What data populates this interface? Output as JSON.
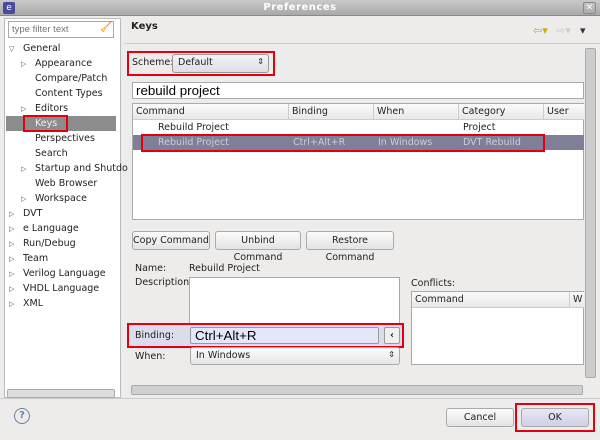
{
  "window": {
    "title": "Preferences"
  },
  "sidebar": {
    "filter_placeholder": "type filter text",
    "items": [
      {
        "label": "General",
        "expanded": true
      },
      {
        "label": "Appearance"
      },
      {
        "label": "Compare/Patch"
      },
      {
        "label": "Content Types"
      },
      {
        "label": "Editors"
      },
      {
        "label": "Keys",
        "selected": true
      },
      {
        "label": "Perspectives"
      },
      {
        "label": "Search"
      },
      {
        "label": "Startup and Shutdo"
      },
      {
        "label": "Web Browser"
      },
      {
        "label": "Workspace"
      },
      {
        "label": "DVT"
      },
      {
        "label": "e Language"
      },
      {
        "label": "Run/Debug"
      },
      {
        "label": "Team"
      },
      {
        "label": "Verilog Language"
      },
      {
        "label": "VHDL Language"
      },
      {
        "label": "XML"
      }
    ]
  },
  "main": {
    "title": "Keys",
    "scheme_label": "Scheme:",
    "scheme_value": "Default",
    "search_value": "rebuild project",
    "table": {
      "columns": [
        "Command",
        "Binding",
        "When",
        "Category",
        "User"
      ],
      "rows": [
        [
          "Rebuild Project",
          "",
          "",
          "Project",
          ""
        ],
        [
          "Rebuild Project",
          "Ctrl+Alt+R",
          "In Windows",
          "DVT Rebuild",
          ""
        ]
      ]
    },
    "buttons": {
      "copy": "Copy Command",
      "unbind": "Unbind Command",
      "restore": "Restore Command"
    },
    "name_label": "Name:",
    "name_value": "Rebuild Project",
    "description_label": "Description:",
    "binding_label": "Binding:",
    "binding_value": "Ctrl+Alt+R",
    "when_label": "When:",
    "when_value": "In Windows",
    "conflicts_label": "Conflicts:",
    "conflicts_columns": [
      "Command",
      "W"
    ]
  },
  "footer": {
    "cancel": "Cancel",
    "ok": "OK"
  },
  "colors": {
    "highlight": "#e00010",
    "selection": "#7f7f98"
  }
}
